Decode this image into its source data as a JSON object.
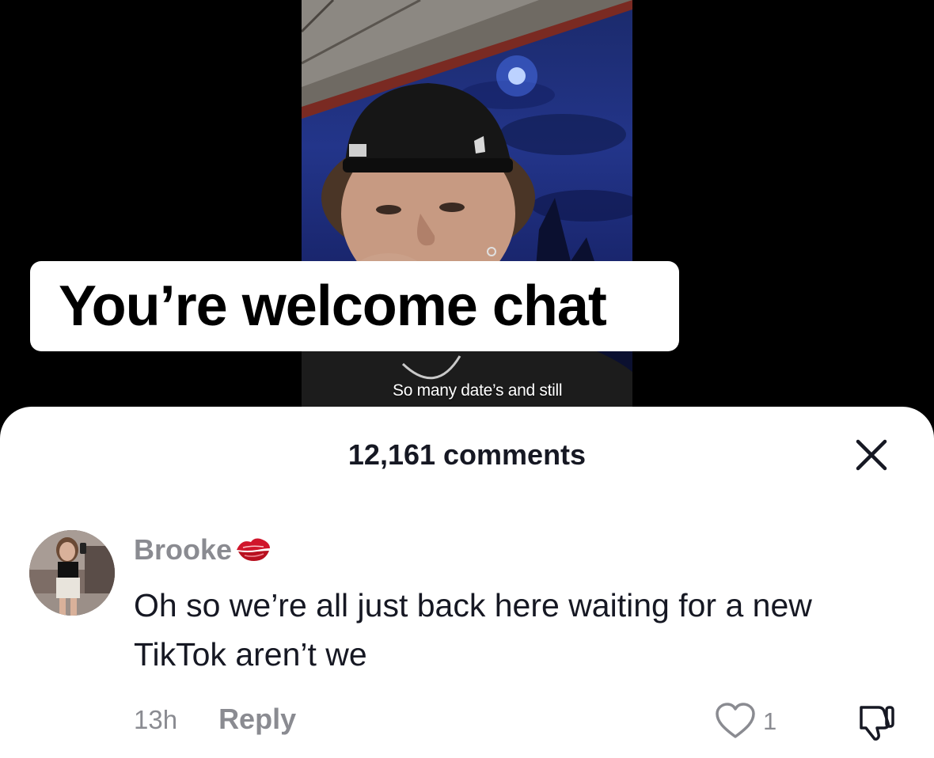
{
  "video": {
    "caption": "You’re welcome chat",
    "subtitle": "So many date’s and still"
  },
  "comments_panel": {
    "title": "12,161 comments",
    "close_icon": "close-icon"
  },
  "comment": {
    "username": "Brooke",
    "username_emoji_icon": "kiss-mark-icon",
    "text": "Oh so we’re all just back here waiting for a new TikTok aren’t we",
    "timestamp": "13h",
    "reply_label": "Reply",
    "like_icon": "heart-outline-icon",
    "like_count": "1",
    "dislike_icon": "thumbs-down-icon"
  },
  "colors": {
    "muted_text": "#8a8b91",
    "primary_text": "#161823",
    "sheet_background": "#ffffff",
    "kiss_red": "#d0152b"
  }
}
